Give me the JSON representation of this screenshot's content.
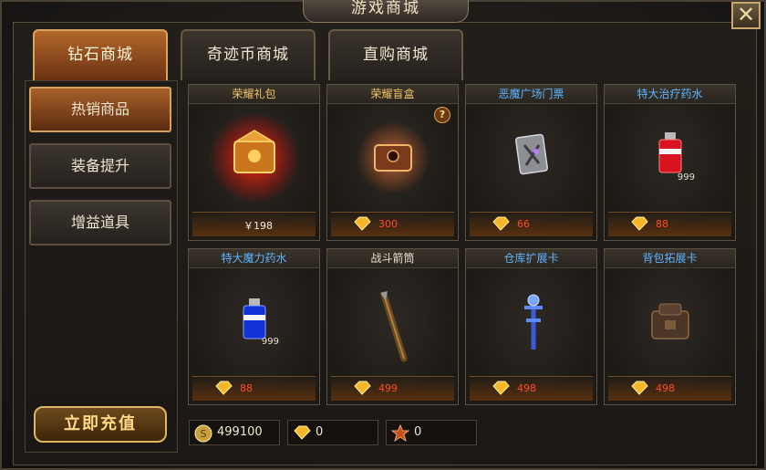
{
  "window": {
    "title": "游戏商城",
    "close_label": "✕"
  },
  "tabs": [
    {
      "label": "钻石商城",
      "active": true
    },
    {
      "label": "奇迹币商城",
      "active": false
    },
    {
      "label": "直购商城",
      "active": false
    }
  ],
  "sidebar": {
    "items": [
      {
        "label": "热销商品",
        "active": true
      },
      {
        "label": "装备提升",
        "active": false
      },
      {
        "label": "增益道具",
        "active": false
      }
    ],
    "recharge_label": "立即充值"
  },
  "items": [
    {
      "name": "荣耀礼包",
      "title_color": "gold",
      "price": "￥198",
      "currency": "rmb",
      "icon": "glory-gift-icon"
    },
    {
      "name": "荣耀盲盒",
      "title_color": "gold",
      "price": "300",
      "currency": "diamond",
      "icon": "glory-blind-box-icon",
      "help": "?"
    },
    {
      "name": "恶魔广场门票",
      "title_color": "blue",
      "price": "66",
      "currency": "diamond",
      "icon": "demon-square-ticket-icon"
    },
    {
      "name": "特大治疗药水",
      "title_color": "blue",
      "price": "88",
      "currency": "diamond",
      "quantity": "999",
      "icon": "red-potion-icon"
    },
    {
      "name": "特大魔力药水",
      "title_color": "blue",
      "price": "88",
      "currency": "diamond",
      "quantity": "999",
      "icon": "blue-potion-icon"
    },
    {
      "name": "战斗箭筒",
      "title_color": "white",
      "price": "499",
      "currency": "diamond",
      "icon": "quiver-icon"
    },
    {
      "name": "仓库扩展卡",
      "title_color": "blue",
      "price": "498",
      "currency": "diamond",
      "icon": "warehouse-card-icon"
    },
    {
      "name": "背包拓展卡",
      "title_color": "blue",
      "price": "498",
      "currency": "diamond",
      "icon": "backpack-card-icon"
    }
  ],
  "currencies": [
    {
      "icon": "coin-icon",
      "value": "499100"
    },
    {
      "icon": "diamond-icon",
      "value": "0"
    },
    {
      "icon": "badge-icon",
      "value": "0"
    }
  ],
  "colors": {
    "price_red": "#ff4a2c",
    "title_gold": "#f3c46a",
    "title_blue": "#5fb4ff",
    "tab_active": "#b2672a"
  }
}
